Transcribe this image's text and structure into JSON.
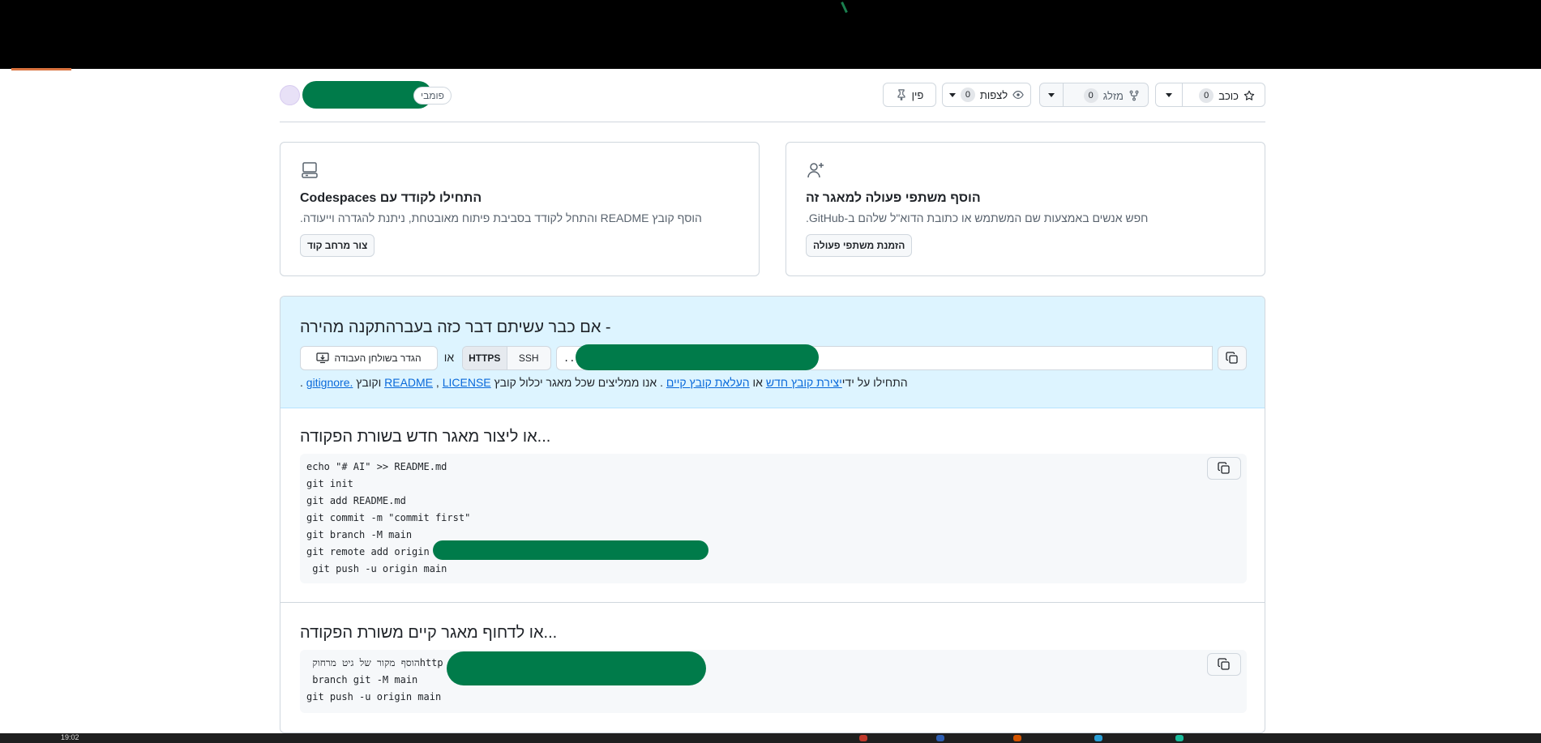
{
  "header": {
    "public_badge": "פומבי",
    "pin_label": "פין",
    "watch_label": "לצפות",
    "watch_count": "0",
    "fork_label": "מזלג",
    "fork_count": "0",
    "star_label": "כוכב",
    "star_count": "0"
  },
  "cards": {
    "codespaces": {
      "title": "התחילו לקודד עם Codespaces",
      "description": "הוסף קובץ README והתחל לקודד בסביבת פיתוח מאובטחת, ניתנת להגדרה וייעודה.",
      "button": "צור מרחב קוד"
    },
    "collaborators": {
      "title": "הוסף משתפי פעולה למאגר זה",
      "description": "חפש אנשים באמצעות שם המשתמש או כתובת הדוא\"ל שלהם ב-GitHub.",
      "button": "הזמנת משתפי פעולה"
    }
  },
  "quick_setup": {
    "title": "התקנה מהירה",
    "title_suffix": "- אם כבר עשיתם דבר כזה בעבר",
    "desktop_button": "הגדר בשולחן העבודה",
    "or": "או",
    "protocols": [
      "HTTPS",
      "SSH"
    ],
    "url_fragment": "...",
    "hint_prefix": "התחילו על ידי",
    "link_new_file": "יצירת קובץ חדש",
    "hint_or": "או",
    "link_upload": "העלאת קובץ קיים",
    "hint_recommend": ". אנו ממליצים שכל מאגר יכלול קובץ",
    "link_readme": "README",
    "link_license": "LICENSE",
    "hint_and": "וקובץ",
    "link_gitignore": ".gitignore",
    "hint_end": "."
  },
  "create_section": {
    "title": "...או ליצור מאגר חדש בשורת הפקודה",
    "code_lines": [
      "echo \"# AI\" >> README.md",
      "git init",
      "git add README.md",
      "git commit -m \"commit first\"",
      "git branch -M main",
      "git remote add origin",
      " git push -u origin main"
    ]
  },
  "push_section": {
    "title": "...או לדחוף מאגר קיים משורת הפקודה",
    "code_lines": [
      " הוסף מקור של גיט מרחוקhttp",
      " branch git -M main",
      "git push -u origin main"
    ]
  },
  "taskbar": {
    "clock": "19:02"
  },
  "colors": {
    "accent": "#0969da",
    "quick_bg": "#ddf4ff",
    "redaction": "#007b4a"
  }
}
